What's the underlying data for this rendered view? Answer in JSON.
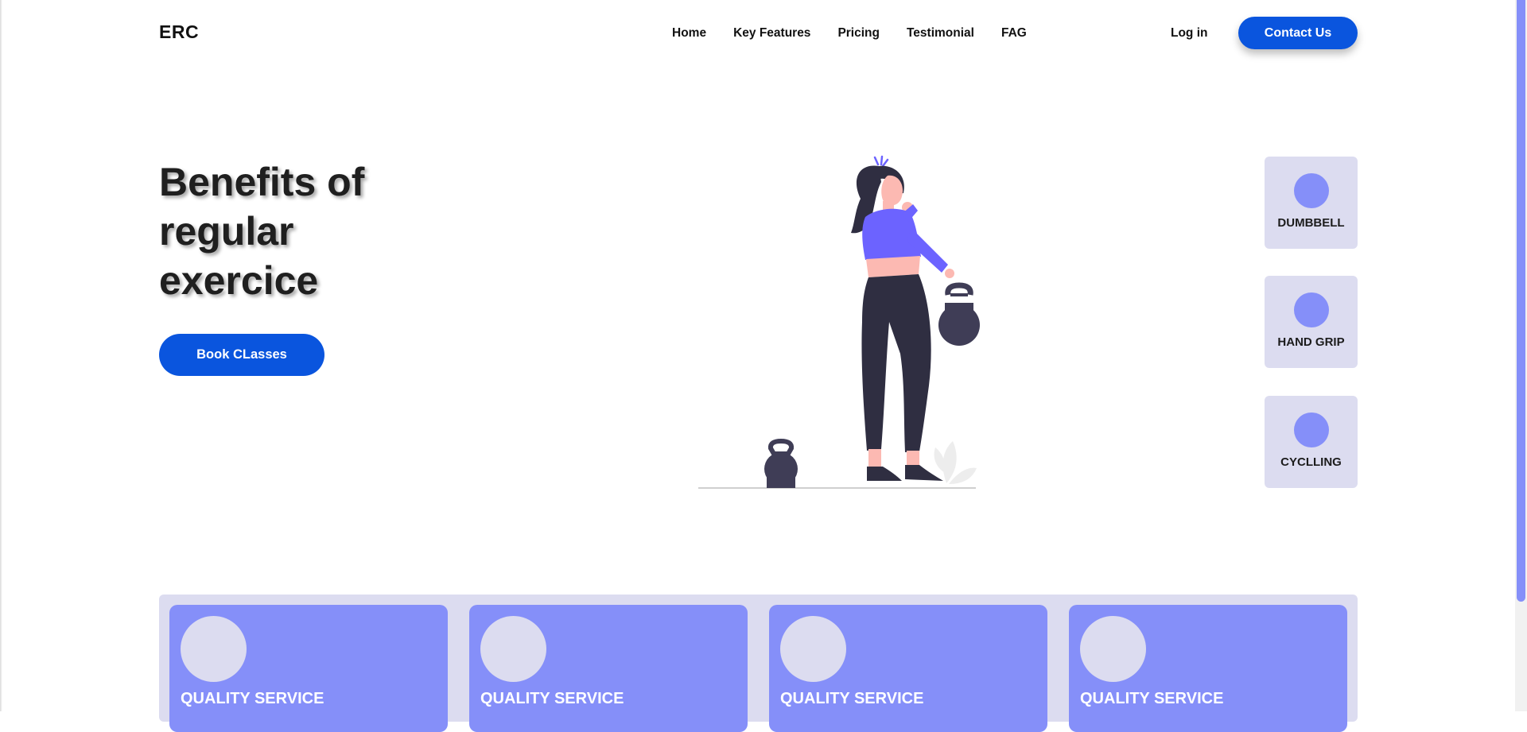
{
  "header": {
    "logo": "ERC",
    "nav": [
      "Home",
      "Key Features",
      "Pricing",
      "Testimonial",
      "FAG"
    ],
    "login": "Log in",
    "contact": "Contact Us"
  },
  "hero": {
    "title": "Benefits of regular exercice",
    "cta": "Book CLasses"
  },
  "side_cards": [
    "DUMBBELL",
    "HAND GRIP",
    "CYCLLING"
  ],
  "services": [
    "QUALITY SERVICE",
    "QUALITY SERVICE",
    "QUALITY SERVICE",
    "QUALITY SERVICE"
  ],
  "colors": {
    "primary": "#0a55de",
    "accent": "#858ff9",
    "card_bg": "#dcdcf0",
    "figure_purple": "#6c63ff",
    "kettlebell": "#3f3d56"
  }
}
